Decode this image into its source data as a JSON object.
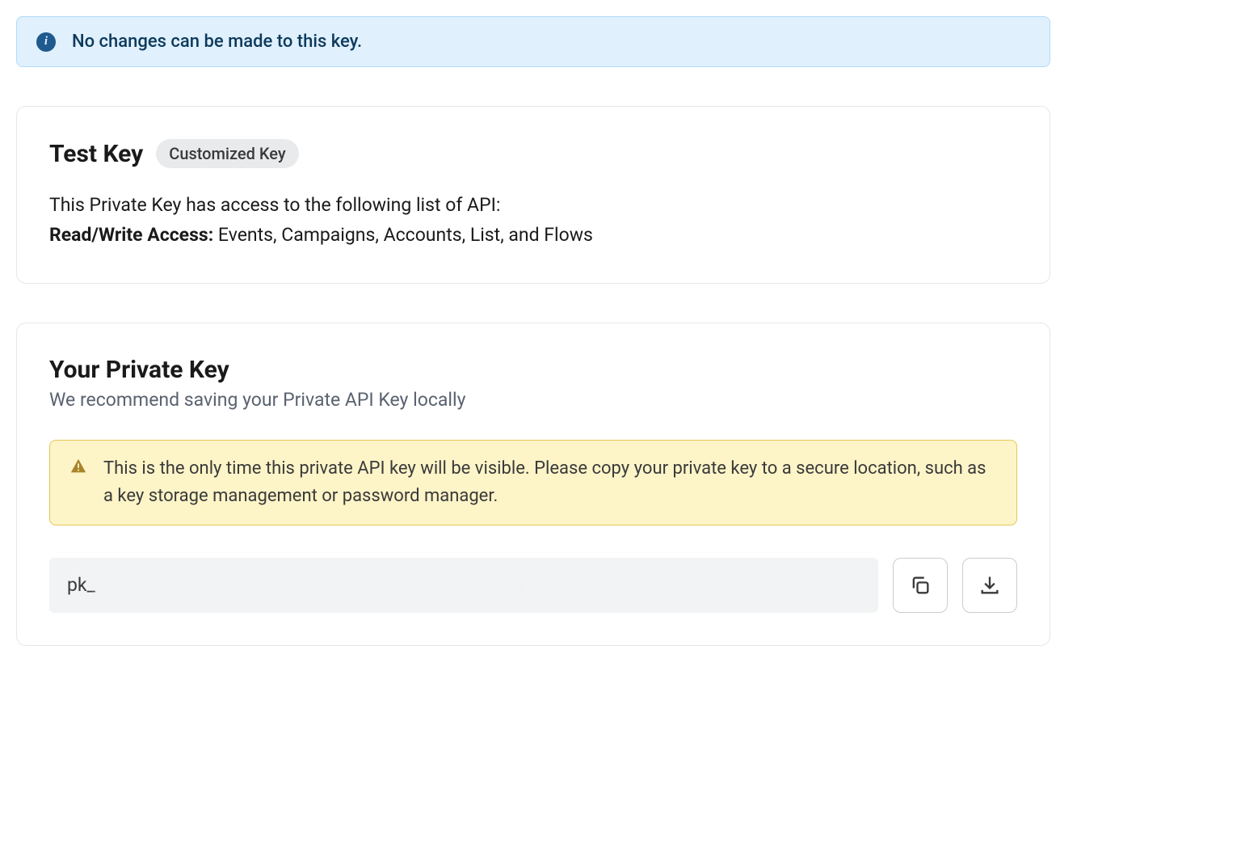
{
  "info_banner": {
    "text": "No changes can be made to this key."
  },
  "key_card": {
    "title": "Test Key",
    "badge": "Customized Key",
    "description_line1": "This Private Key has access to the following list of API:",
    "access_label": "Read/Write Access:",
    "access_value": " Events, Campaigns, Accounts, List, and Flows"
  },
  "private_key_card": {
    "title": "Your Private Key",
    "subtitle": "We recommend saving your Private API Key locally",
    "warning_text": "This is the only time this private API key will be visible. Please copy your private key to a secure location, such as a key storage management or password manager.",
    "key_prefix": "pk_"
  }
}
